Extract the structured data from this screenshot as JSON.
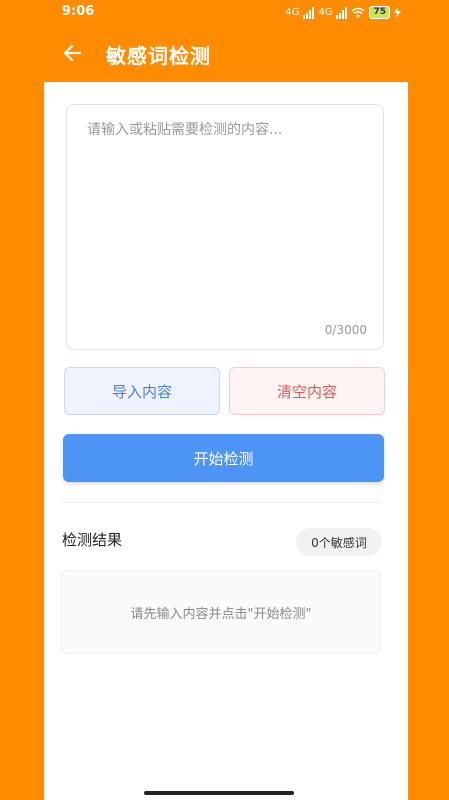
{
  "status_bar": {
    "time": "9:06",
    "network_1": "4G",
    "network_2": "4G",
    "battery": "75"
  },
  "app_bar": {
    "title": "敏感词检测",
    "back_icon": "arrow-left-icon"
  },
  "editor": {
    "value": "",
    "placeholder": "请输入或粘贴需要检测的内容...",
    "counter": "0/3000"
  },
  "actions": {
    "import_label": "导入内容",
    "clear_label": "清空内容",
    "start_label": "开始检测"
  },
  "result": {
    "title": "检测结果",
    "count_badge": "0个敏感词",
    "empty_hint": "请先输入内容并点击\"开始检测\""
  },
  "colors": {
    "background": "#FF8C00",
    "primary": "#4D95F5",
    "danger": "#E05A5A"
  }
}
